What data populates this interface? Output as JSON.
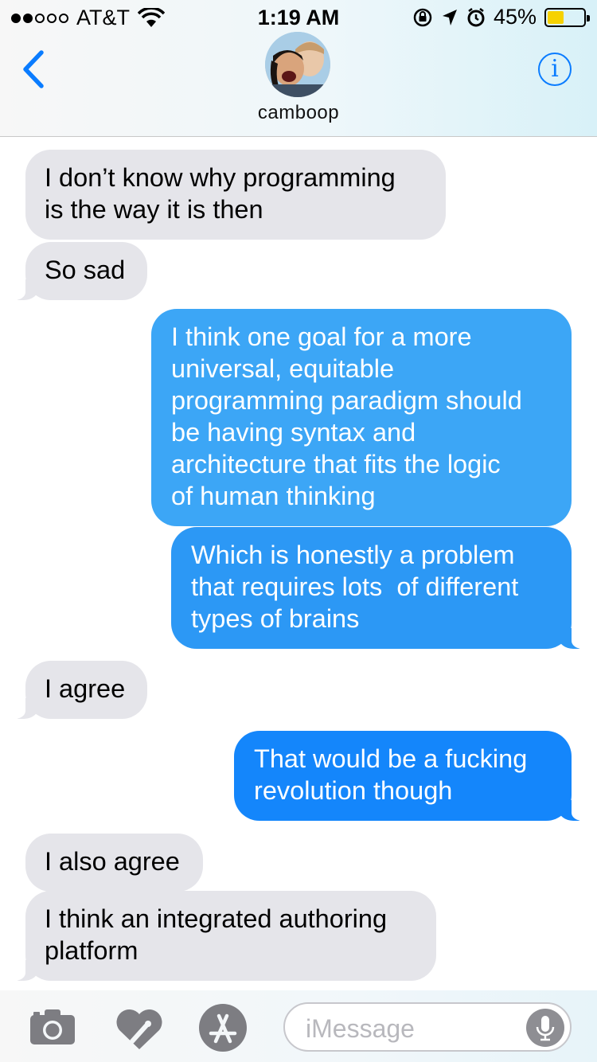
{
  "status_bar": {
    "carrier": "AT&T",
    "time": "1:19 AM",
    "battery_percent": "45%",
    "battery_level": 0.45,
    "signal_bars_filled": 2,
    "signal_bars_total": 5
  },
  "header": {
    "contact_name": "camboop",
    "back_icon": "chevron-left-icon",
    "info_icon": "info-icon"
  },
  "messages": [
    {
      "direction": "received",
      "text": "I don’t know why programming\nis the way it is then"
    },
    {
      "direction": "received",
      "text": "So sad"
    },
    {
      "direction": "sent",
      "text": "I think one goal for a more\nuniversal, equitable\nprogramming paradigm should\nbe having syntax and\narchitecture that fits the logic\nof human thinking"
    },
    {
      "direction": "sent",
      "text": "Which is honestly a problem\nthat requires lots  of different\ntypes of brains"
    },
    {
      "direction": "received",
      "text": "I agree"
    },
    {
      "direction": "sent",
      "text": "That would be a fucking\nrevolution though"
    },
    {
      "direction": "received",
      "text": "I also agree"
    },
    {
      "direction": "received",
      "text": "I think an integrated authoring\nplatform"
    }
  ],
  "input_bar": {
    "placeholder": "iMessage",
    "tools": [
      "camera-icon",
      "digital-touch-icon",
      "app-store-icon"
    ],
    "mic_icon": "microphone-icon"
  },
  "colors": {
    "received_bubble": "#e5e5ea",
    "sent_bubble_top": "#4ab1f8",
    "sent_bubble_bottom": "#0a7cff",
    "accent": "#0a7cff",
    "battery": "#f6d200"
  }
}
